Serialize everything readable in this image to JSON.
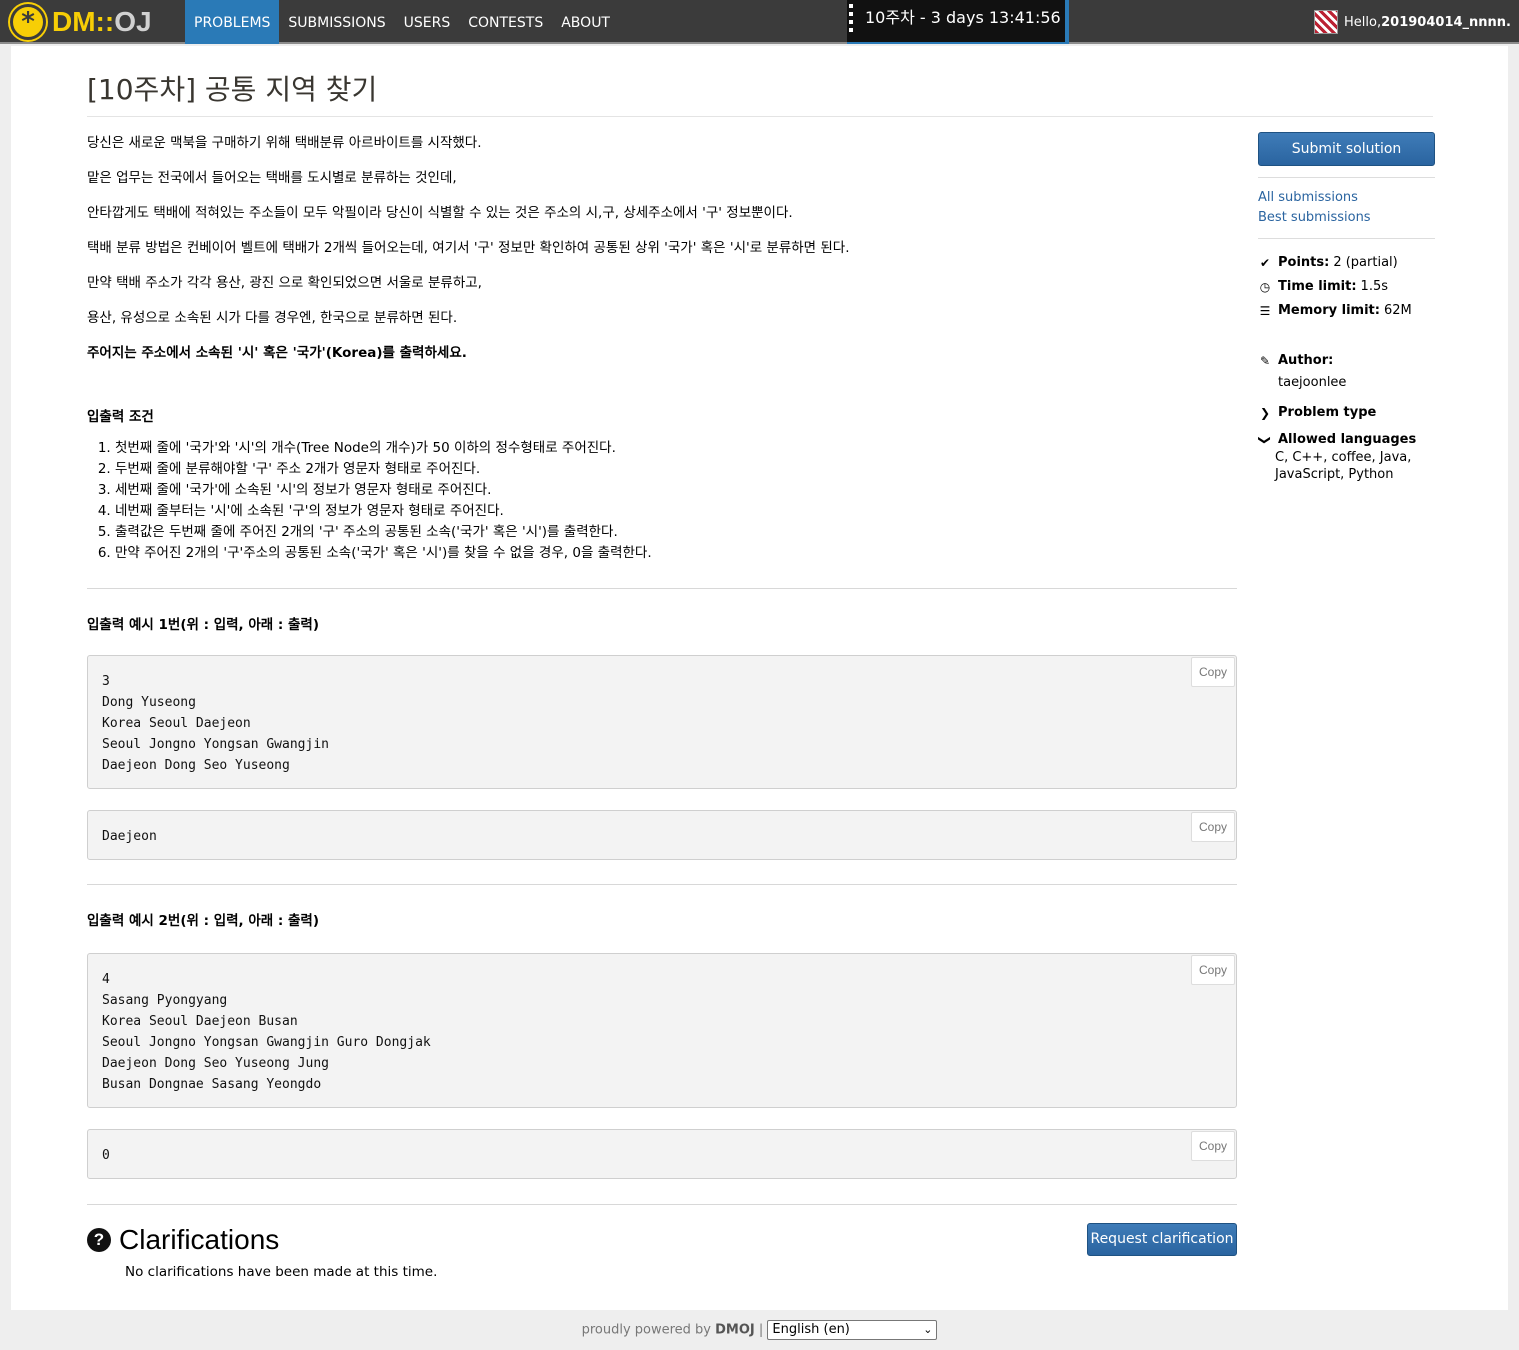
{
  "nav": {
    "logo_dm": "DM::",
    "logo_oj": "OJ",
    "items": [
      {
        "label": "PROBLEMS",
        "active": true
      },
      {
        "label": "SUBMISSIONS",
        "active": false
      },
      {
        "label": "USERS",
        "active": false
      },
      {
        "label": "CONTESTS",
        "active": false
      },
      {
        "label": "ABOUT",
        "active": false
      }
    ],
    "contest_timer": "10주차 - 3 days 13:41:56",
    "greeting": "Hello, ",
    "username": "201904014_nnnn."
  },
  "problem": {
    "title": "[10주차] 공통 지역 찾기",
    "paragraphs": [
      "당신은 새로운 맥북을 구매하기 위해 택배분류 아르바이트를 시작했다.",
      "맡은 업무는 전국에서 들어오는 택배를 도시별로 분류하는 것인데,",
      "안타깝게도 택배에 적혀있는 주소들이 모두 악필이라 당신이 식별할 수 있는 것은 주소의 시,구, 상세주소에서 '구' 정보뿐이다.",
      "택배 분류 방법은 컨베이어 벨트에 택배가 2개씩 들어오는데, 여기서 '구' 정보만 확인하여 공통된 상위 '국가' 혹은 '시'로 분류하면 된다.",
      "만약 택배 주소가 각각 용산, 광진 으로 확인되었으면 서울로 분류하고,",
      "용산, 유성으로 소속된 시가 다를 경우엔, 한국으로 분류하면 된다."
    ],
    "bold_instruction": "주어지는 주소에서 소속된 '시' 혹은 '국가'(Korea)를 출력하세요.",
    "io_heading": "입출력 조건",
    "io_conditions": [
      "첫번째 줄에 '국가'와 '시'의 개수(Tree Node의 개수)가 50 이하의 정수형태로 주어진다.",
      "두번째 줄에 분류해야할 '구' 주소 2개가 영문자 형태로 주어진다.",
      "세번째 줄에 '국가'에 소속된 '시'의 정보가 영문자 형태로 주어진다.",
      "네번째 줄부터는 '시'에 소속된 '구'의 정보가 영문자 형태로 주어진다.",
      "출력값은 두번째 줄에 주어진 2개의 '구' 주소의 공통된 소속('국가' 혹은 '시')를 출력한다.",
      "만약 주어진 2개의 '구'주소의 공통된 소속('국가' 혹은 '시')를 찾을 수 없을 경우, 0을 출력한다."
    ],
    "examples": [
      {
        "heading": "입출력 예시 1번(위 : 입력, 아래 : 출력)",
        "input": "3\nDong Yuseong\nKorea Seoul Daejeon\nSeoul Jongno Yongsan Gwangjin\nDaejeon Dong Seo Yuseong",
        "output": "Daejeon"
      },
      {
        "heading": "입출력 예시 2번(위 : 입력, 아래 : 출력)",
        "input": "4\nSasang Pyongyang\nKorea Seoul Daejeon Busan\nSeoul Jongno Yongsan Gwangjin Guro Dongjak\nDaejeon Dong Seo Yuseong Jung\nBusan Dongnae Sasang Yeongdo",
        "output": "0"
      }
    ],
    "copy_label": "Copy"
  },
  "sidebar": {
    "submit_label": "Submit solution",
    "all_submissions": "All submissions",
    "best_submissions": "Best submissions",
    "points_label": "Points:",
    "points_value": "2 (partial)",
    "time_label": "Time limit:",
    "time_value": "1.5s",
    "memory_label": "Memory limit:",
    "memory_value": "62M",
    "author_label": "Author:",
    "author_value": "taejoonlee",
    "problem_type_label": "Problem type",
    "allowed_languages_label": "Allowed languages",
    "allowed_languages_value": "C, C++, coffee, Java, JavaScript, Python"
  },
  "clarifications": {
    "title": "Clarifications",
    "empty_text": "No clarifications have been made at this time.",
    "request_label": "Request clarification"
  },
  "footer": {
    "powered_text": "proudly powered by ",
    "brand": "DMOJ",
    "separator": " | ",
    "language": "English (en)"
  }
}
